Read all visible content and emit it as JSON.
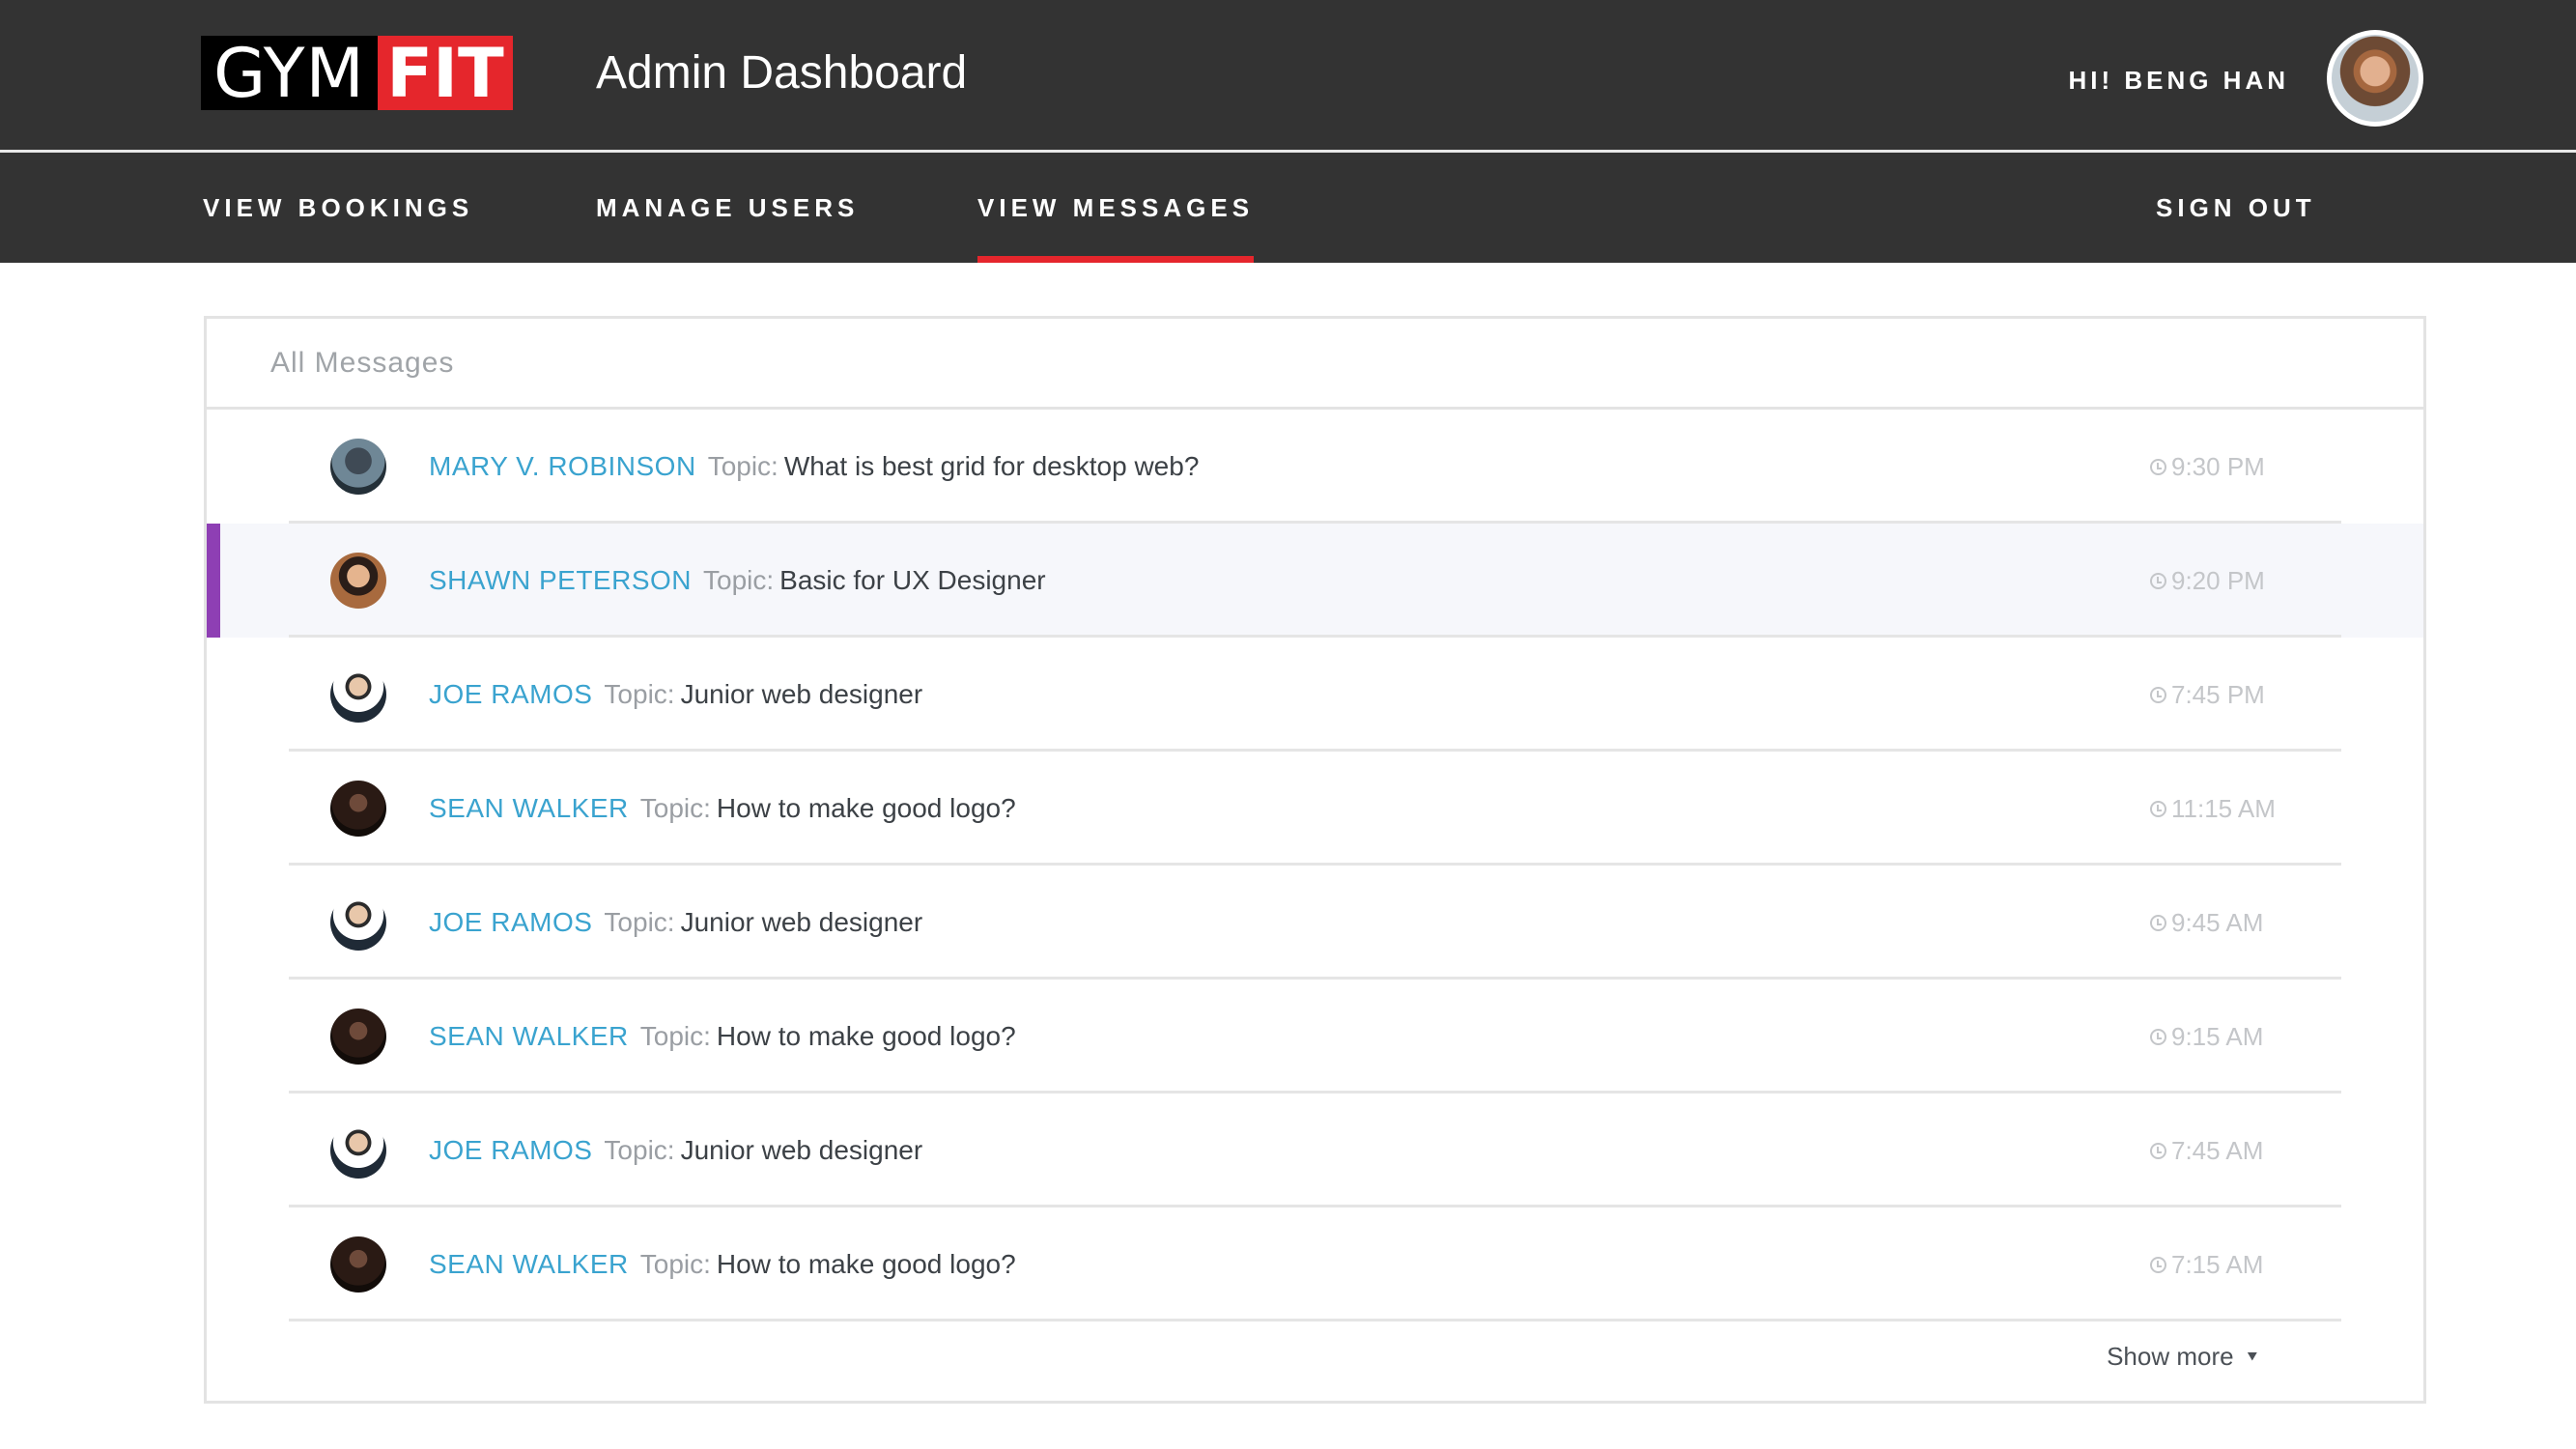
{
  "header": {
    "logo": {
      "part1": "GYM",
      "part2": "FIT"
    },
    "title": "Admin Dashboard",
    "greeting": "HI! BENG HAN",
    "avatar_icon": "user-avatar"
  },
  "nav": {
    "items": [
      {
        "label": "VIEW BOOKINGS",
        "active": false
      },
      {
        "label": "MANAGE USERS",
        "active": false
      },
      {
        "label": "VIEW MESSAGES",
        "active": true
      }
    ],
    "signout": "SIGN OUT"
  },
  "colors": {
    "brand_red": "#e5262c",
    "bar_dark": "#333333",
    "name_blue": "#3aa3cf",
    "highlight_purple": "#8e3fb4"
  },
  "messages": {
    "heading": "All Messages",
    "topic_label": "Topic:",
    "items": [
      {
        "name": "MARY V. ROBINSON",
        "topic": "What is best grid for desktop web?",
        "time": "9:30 PM",
        "highlighted": false
      },
      {
        "name": "SHAWN PETERSON",
        "topic": "Basic for UX Designer",
        "time": "9:20 PM",
        "highlighted": true
      },
      {
        "name": "JOE RAMOS",
        "topic": "Junior web designer",
        "time": "7:45 PM",
        "highlighted": false
      },
      {
        "name": "SEAN WALKER",
        "topic": "How to make good logo?",
        "time": "11:15 AM",
        "highlighted": false
      },
      {
        "name": "JOE RAMOS",
        "topic": "Junior web designer",
        "time": "9:45 AM",
        "highlighted": false
      },
      {
        "name": "SEAN WALKER",
        "topic": "How to make good logo?",
        "time": "9:15 AM",
        "highlighted": false
      },
      {
        "name": "JOE RAMOS",
        "topic": "Junior web designer",
        "time": "7:45 AM",
        "highlighted": false
      },
      {
        "name": "SEAN WALKER",
        "topic": "How to make good logo?",
        "time": "7:15 AM",
        "highlighted": false
      }
    ],
    "show_more": "Show more",
    "time_icon": "clock-icon",
    "show_more_icon": "double-chevron-down-icon"
  }
}
